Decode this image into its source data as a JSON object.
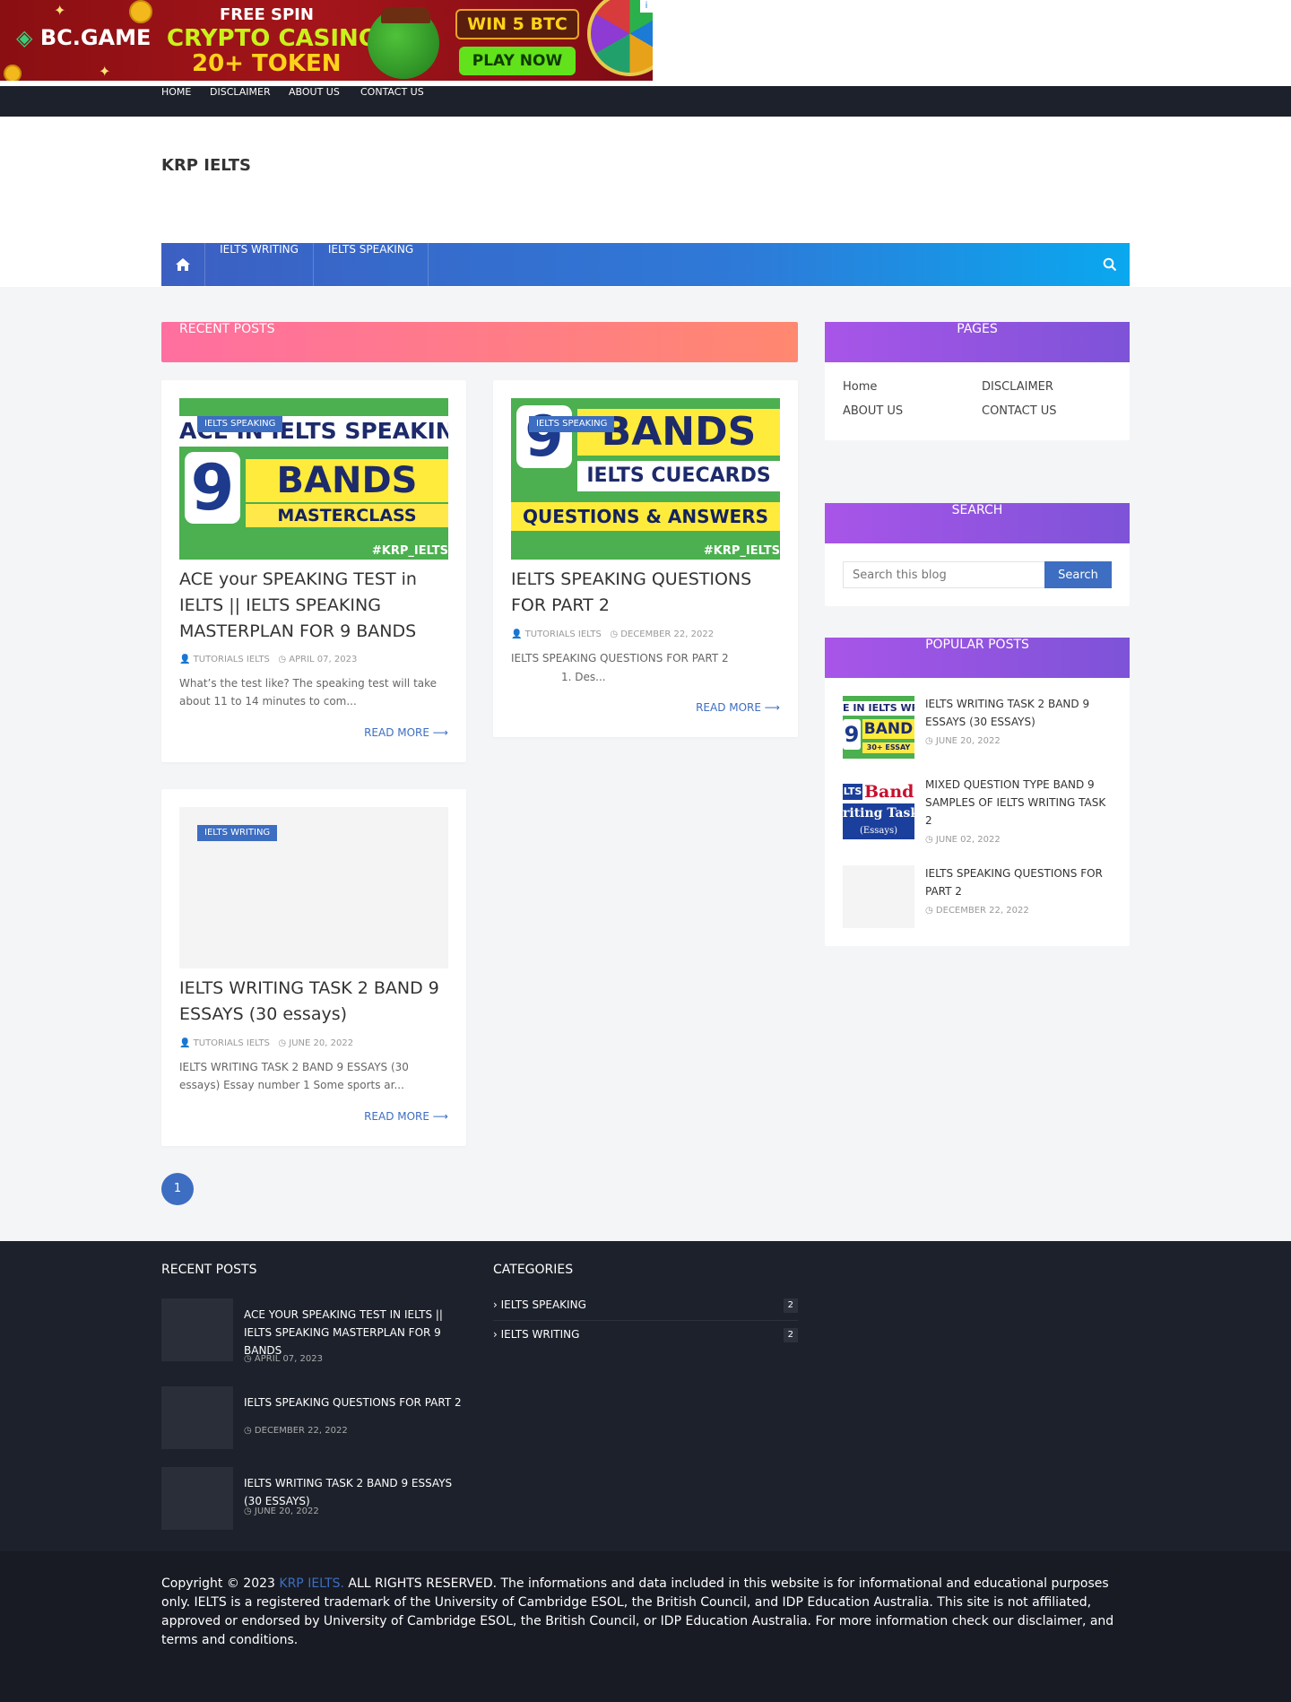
{
  "ad": {
    "logo": "BC.GAME",
    "free_spin": "FREE SPIN",
    "casino": "CRYPTO CASINO",
    "token": "20+ TOKEN",
    "win": "WIN 5 BTC",
    "play": "PLAY NOW"
  },
  "top_nav": [
    "HOME",
    "DISCLAIMER",
    "ABOUT US",
    "CONTACT US"
  ],
  "site": {
    "title": "KRP IELTS"
  },
  "main_nav": [
    "IELTS WRITING",
    "IELTS SPEAKING"
  ],
  "recent_heading": "RECENT POSTS",
  "posts": [
    {
      "label": "IELTS SPEAKING",
      "thumb": {
        "line1": "ACE IN IELTS SPEAKING",
        "nine": "9",
        "bands": "BANDS",
        "sub": "MASTERCLASS",
        "hash": "#KRP_IELTS"
      },
      "title": "ACE your SPEAKING TEST in IELTS || IELTS SPEAKING MASTERPLAN FOR 9 BANDS",
      "author": "TUTORIALS IELTS",
      "date": "APRIL 07, 2023",
      "excerpt": "What’s the test like? The speaking test will take about 11 to 14 minutes to com...",
      "read_more": "READ MORE"
    },
    {
      "label": "IELTS SPEAKING",
      "thumb": {
        "nine": "9",
        "bands": "BANDS",
        "sub2": "IELTS CUECARDS",
        "sub": "QUESTIONS & ANSWERS",
        "hash": "#KRP_IELTS"
      },
      "title": "IELTS SPEAKING QUESTIONS FOR PART 2",
      "author": "TUTORIALS IELTS",
      "date": "DECEMBER 22, 2022",
      "excerpt_line1": "IELTS SPEAKING QUESTIONS FOR PART 2",
      "excerpt_line2": "1. Des...",
      "read_more": "READ MORE"
    },
    {
      "label": "IELTS WRITING",
      "title": "IELTS WRITING TASK 2 BAND 9 ESSAYS (30 essays)",
      "author": "TUTORIALS IELTS",
      "date": "JUNE 20, 2022",
      "excerpt": "IELTS WRITING TASK 2 BAND 9 ESSAYS (30 essays) Essay number 1 Some sports ar...",
      "read_more": "READ MORE"
    }
  ],
  "pagination": {
    "current": "1"
  },
  "sidebar": {
    "pages": {
      "title": "PAGES",
      "links": [
        "Home",
        "DISCLAIMER",
        "ABOUT US",
        "CONTACT US"
      ]
    },
    "search": {
      "title": "SEARCH",
      "placeholder": "Search this blog",
      "button": "Search"
    },
    "popular": {
      "title": "POPULAR POSTS",
      "items": [
        {
          "title": "IELTS WRITING TASK 2 BAND 9 ESSAYS (30 essays)",
          "date": "JUNE 20, 2022",
          "thumb_text1": "E IN IELTS WRIT",
          "thumb_text2": "BAND",
          "thumb_text3": "30+ ESSAY"
        },
        {
          "title": "MIXED QUESTION TYPE BAND 9 SAMPLES OF IELTS WRITING TASK 2",
          "date": "JUNE 02, 2022",
          "thumb_text1": "LTS",
          "thumb_text2": "Band",
          "thumb_text3": "riting Task",
          "thumb_text4": "(Essays)"
        },
        {
          "title": "IELTS SPEAKING QUESTIONS FOR PART 2",
          "date": "DECEMBER 22, 2022"
        }
      ]
    }
  },
  "footer": {
    "recent": {
      "title": "RECENT POSTS",
      "items": [
        {
          "title": "ACE your SPEAKING TEST in IELTS || IELTS SPEAKING MASTERPLAN FOR 9 BANDS",
          "date": "APRIL 07, 2023"
        },
        {
          "title": "IELTS SPEAKING QUESTIONS FOR PART 2",
          "date": "DECEMBER 22, 2022"
        },
        {
          "title": "IELTS WRITING TASK 2 BAND 9 ESSAYS (30 essays)",
          "date": "JUNE 20, 2022"
        }
      ]
    },
    "categories": {
      "title": "CATEGORIES",
      "items": [
        {
          "name": "IELTS SPEAKING",
          "count": "2"
        },
        {
          "name": "IELTS WRITING",
          "count": "2"
        }
      ]
    }
  },
  "copyright": {
    "prefix": "Copyright © 2023 ",
    "brand": "KRP IELTS.",
    "text": " ALL RIGHTS RESERVED. The informations and data included in this website is for informational and educational purposes only. IELTS is a registered trademark of the University of Cambridge ESOL, the British Council, and IDP Education Australia. This site is not affiliated, approved or endorsed by University of Cambridge ESOL, the British Council, or IDP Education Australia. For more information check our disclaimer, and terms and conditions."
  }
}
